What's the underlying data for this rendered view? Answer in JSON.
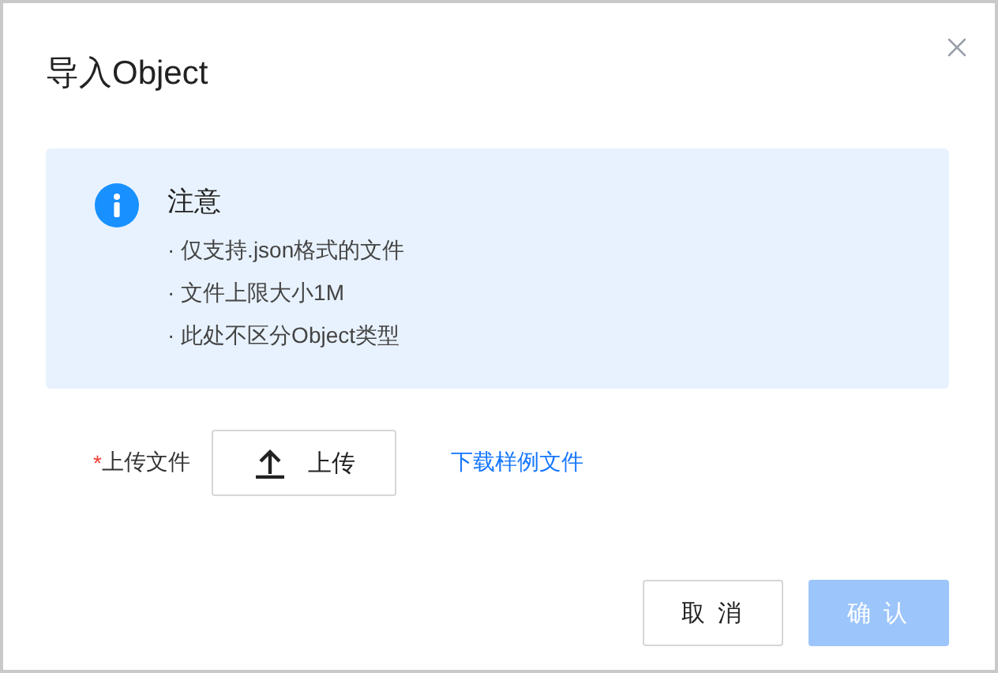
{
  "dialog": {
    "title": "导入Object"
  },
  "notice": {
    "heading": "注意",
    "items": [
      "· 仅支持.json格式的文件",
      "· 文件上限大小1M",
      "· 此处不区分Object类型"
    ]
  },
  "form": {
    "required_mark": "*",
    "label": "上传文件",
    "upload_button": "上传",
    "sample_link": "下载样例文件"
  },
  "buttons": [
    {
      "label": "取 消",
      "kind": "secondary",
      "disabled": false
    },
    {
      "label": "确 认",
      "kind": "primary",
      "disabled": true
    }
  ]
}
